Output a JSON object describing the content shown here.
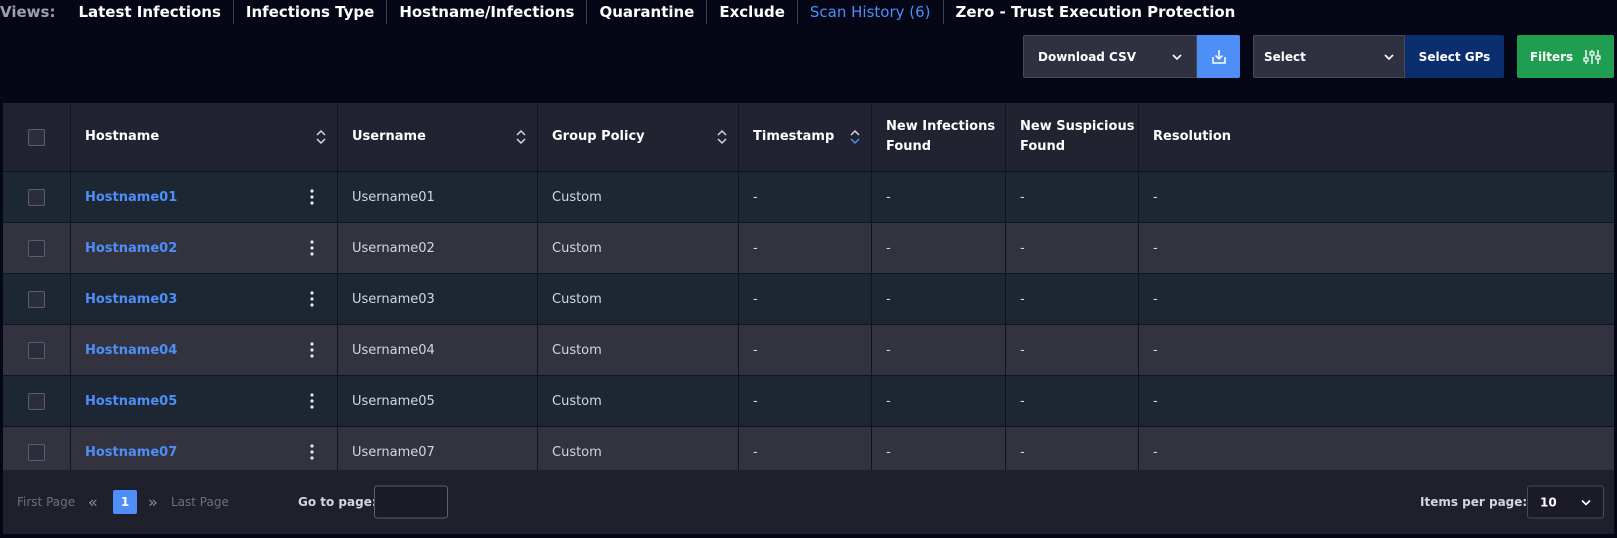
{
  "views": {
    "label": "Views:",
    "tabs": [
      {
        "label": "Latest Infections",
        "active": false
      },
      {
        "label": "Infections Type",
        "active": false
      },
      {
        "label": "Hostname/Infections",
        "active": false
      },
      {
        "label": "Quarantine",
        "active": false
      },
      {
        "label": "Exclude",
        "active": false
      },
      {
        "label": "Scan History (6)",
        "active": true
      },
      {
        "label": "Zero - Trust Execution Protection",
        "active": false
      }
    ]
  },
  "toolbar": {
    "download_select": "Download CSV",
    "download_icon": "download-icon",
    "gp_select": "Select",
    "gp_button": "Select GPs",
    "filters_button": "Filters",
    "filters_icon": "sliders-icon",
    "colors": {
      "accent": "#4d8ef7",
      "filters": "#1f9e52",
      "gp": "#0b2e6e"
    }
  },
  "table": {
    "headers": [
      "Hostname",
      "Username",
      "Group Policy",
      "Timestamp",
      "New Infections Found",
      "New Suspicious Found",
      "Resolution"
    ],
    "rows": [
      {
        "hostname": "Hostname01",
        "username": "Username01",
        "policy": "Custom",
        "timestamp": "-",
        "infections": "-",
        "suspicious": "-",
        "resolution": "-"
      },
      {
        "hostname": "Hostname02",
        "username": "Username02",
        "policy": "Custom",
        "timestamp": "-",
        "infections": "-",
        "suspicious": "-",
        "resolution": "-"
      },
      {
        "hostname": "Hostname03",
        "username": "Username03",
        "policy": "Custom",
        "timestamp": "-",
        "infections": "-",
        "suspicious": "-",
        "resolution": "-"
      },
      {
        "hostname": "Hostname04",
        "username": "Username04",
        "policy": "Custom",
        "timestamp": "-",
        "infections": "-",
        "suspicious": "-",
        "resolution": "-"
      },
      {
        "hostname": "Hostname05",
        "username": "Username05",
        "policy": "Custom",
        "timestamp": "-",
        "infections": "-",
        "suspicious": "-",
        "resolution": "-"
      },
      {
        "hostname": "Hostname07",
        "username": "Username07",
        "policy": "Custom",
        "timestamp": "-",
        "infections": "-",
        "suspicious": "-",
        "resolution": "-"
      }
    ]
  },
  "pagination": {
    "first": "First Page",
    "last": "Last Page",
    "current_page": "1",
    "goto_label": "Go to page:",
    "goto_value": "",
    "items_label": "Items per page:",
    "items_value": "10"
  }
}
